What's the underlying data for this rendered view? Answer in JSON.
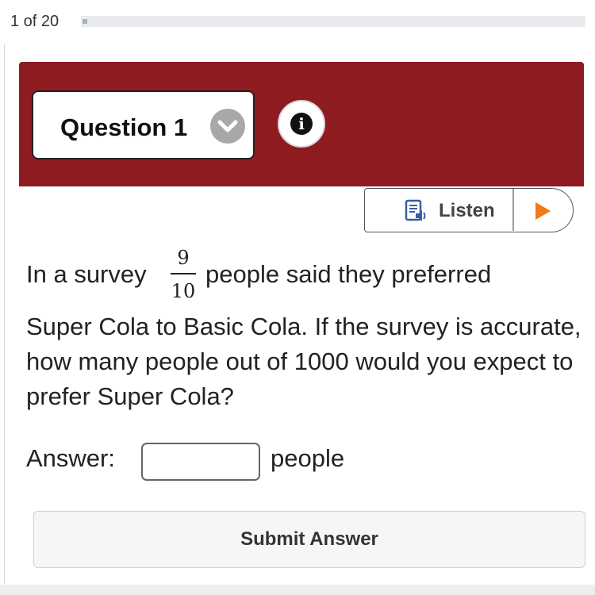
{
  "progress": {
    "text": "1 of 20",
    "value": 0.05
  },
  "header": {
    "question_select_label": "Question 1",
    "info_glyph": "i",
    "color": "#8e1b20"
  },
  "listen": {
    "label": "Listen",
    "icon": "document-speaker-icon",
    "play_icon": "play-icon",
    "play_color": "#f07a13"
  },
  "question": {
    "text_before_fraction": "In a survey",
    "fraction": {
      "numerator": "9",
      "denominator": "10"
    },
    "text_after_fraction": "people said they preferred",
    "text_rest": "Super Cola to Basic Cola. If the survey is accurate, how many people out of 1000 would you expect to prefer Super Cola?"
  },
  "answer": {
    "label": "Answer:",
    "value": "",
    "unit": "people"
  },
  "submit": {
    "label": "Submit Answer"
  }
}
